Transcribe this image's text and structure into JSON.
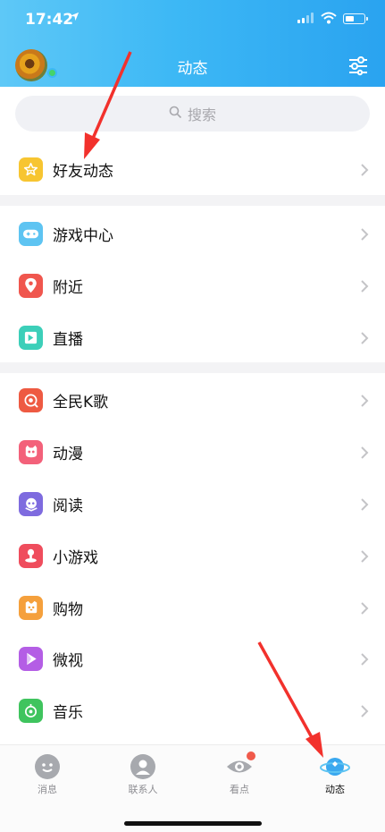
{
  "status": {
    "time": "17:42"
  },
  "header": {
    "title": "动态"
  },
  "search": {
    "placeholder": "搜索"
  },
  "groups": [
    {
      "items": [
        {
          "label": "好友动态",
          "icon": "star-icon",
          "color": "#f7c531"
        }
      ]
    },
    {
      "items": [
        {
          "label": "游戏中心",
          "icon": "gamepad-icon",
          "color": "#5ec4f2"
        },
        {
          "label": "附近",
          "icon": "location-pin-icon",
          "color": "#f0564e"
        },
        {
          "label": "直播",
          "icon": "live-icon",
          "color": "#3ccfb9"
        }
      ]
    },
    {
      "items": [
        {
          "label": "全民K歌",
          "icon": "karaoke-icon",
          "color": "#ee5a42"
        },
        {
          "label": "动漫",
          "icon": "anime-face-icon",
          "color": "#f3617a"
        },
        {
          "label": "阅读",
          "icon": "reading-icon",
          "color": "#7e6bdf"
        },
        {
          "label": "小游戏",
          "icon": "minigame-icon",
          "color": "#ef4d5d"
        },
        {
          "label": "购物",
          "icon": "shopping-icon",
          "color": "#f5a03c"
        },
        {
          "label": "微视",
          "icon": "video-icon",
          "color": "#b45ee5"
        },
        {
          "label": "音乐",
          "icon": "music-icon",
          "color": "#3fc45e"
        }
      ]
    }
  ],
  "tabs": [
    {
      "label": "消息",
      "icon": "chat-icon"
    },
    {
      "label": "联系人",
      "icon": "contacts-icon"
    },
    {
      "label": "看点",
      "icon": "eye-icon"
    },
    {
      "label": "动态",
      "icon": "planet-icon"
    }
  ]
}
